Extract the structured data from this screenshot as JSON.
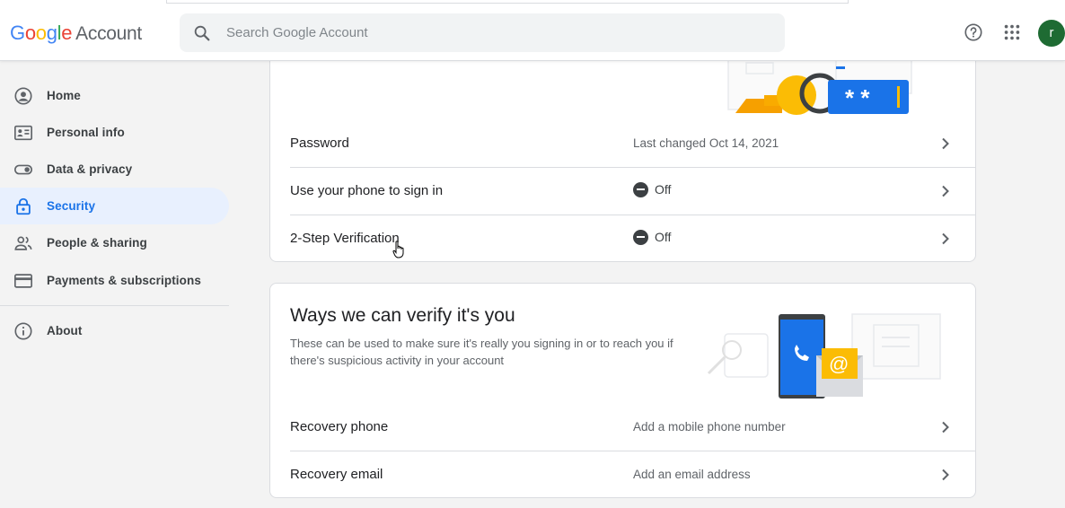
{
  "header": {
    "logo": {
      "g1": "G",
      "o1": "o",
      "o2": "o",
      "g2": "g",
      "l": "l",
      "e": "e",
      "account": "Account"
    },
    "search_placeholder": "Search Google Account",
    "avatar_letter": "r"
  },
  "sidebar": {
    "items": [
      {
        "label": "Home",
        "icon": "account-circle-icon"
      },
      {
        "label": "Personal info",
        "icon": "id-card-icon"
      },
      {
        "label": "Data & privacy",
        "icon": "toggle-icon"
      },
      {
        "label": "Security",
        "icon": "lock-icon",
        "active": true
      },
      {
        "label": "People & sharing",
        "icon": "people-icon"
      },
      {
        "label": "Payments & subscriptions",
        "icon": "credit-card-icon"
      },
      {
        "label": "About",
        "icon": "info-icon"
      }
    ]
  },
  "signin_card": {
    "rows": [
      {
        "label": "Password",
        "value": "Last changed Oct 14, 2021"
      },
      {
        "label": "Use your phone to sign in",
        "status": "Off"
      },
      {
        "label": "2-Step Verification",
        "status": "Off"
      }
    ]
  },
  "verify_card": {
    "title": "Ways we can verify it's you",
    "description": "These can be used to make sure it's really you signing in or to reach you if there's suspicious activity in your account",
    "rows": [
      {
        "label": "Recovery phone",
        "value": "Add a mobile phone number"
      },
      {
        "label": "Recovery email",
        "value": "Add an email address"
      }
    ]
  },
  "colors": {
    "accent": "#1a73e8",
    "active_bg": "#e8f0fe",
    "avatar_bg": "#1e6b33"
  }
}
